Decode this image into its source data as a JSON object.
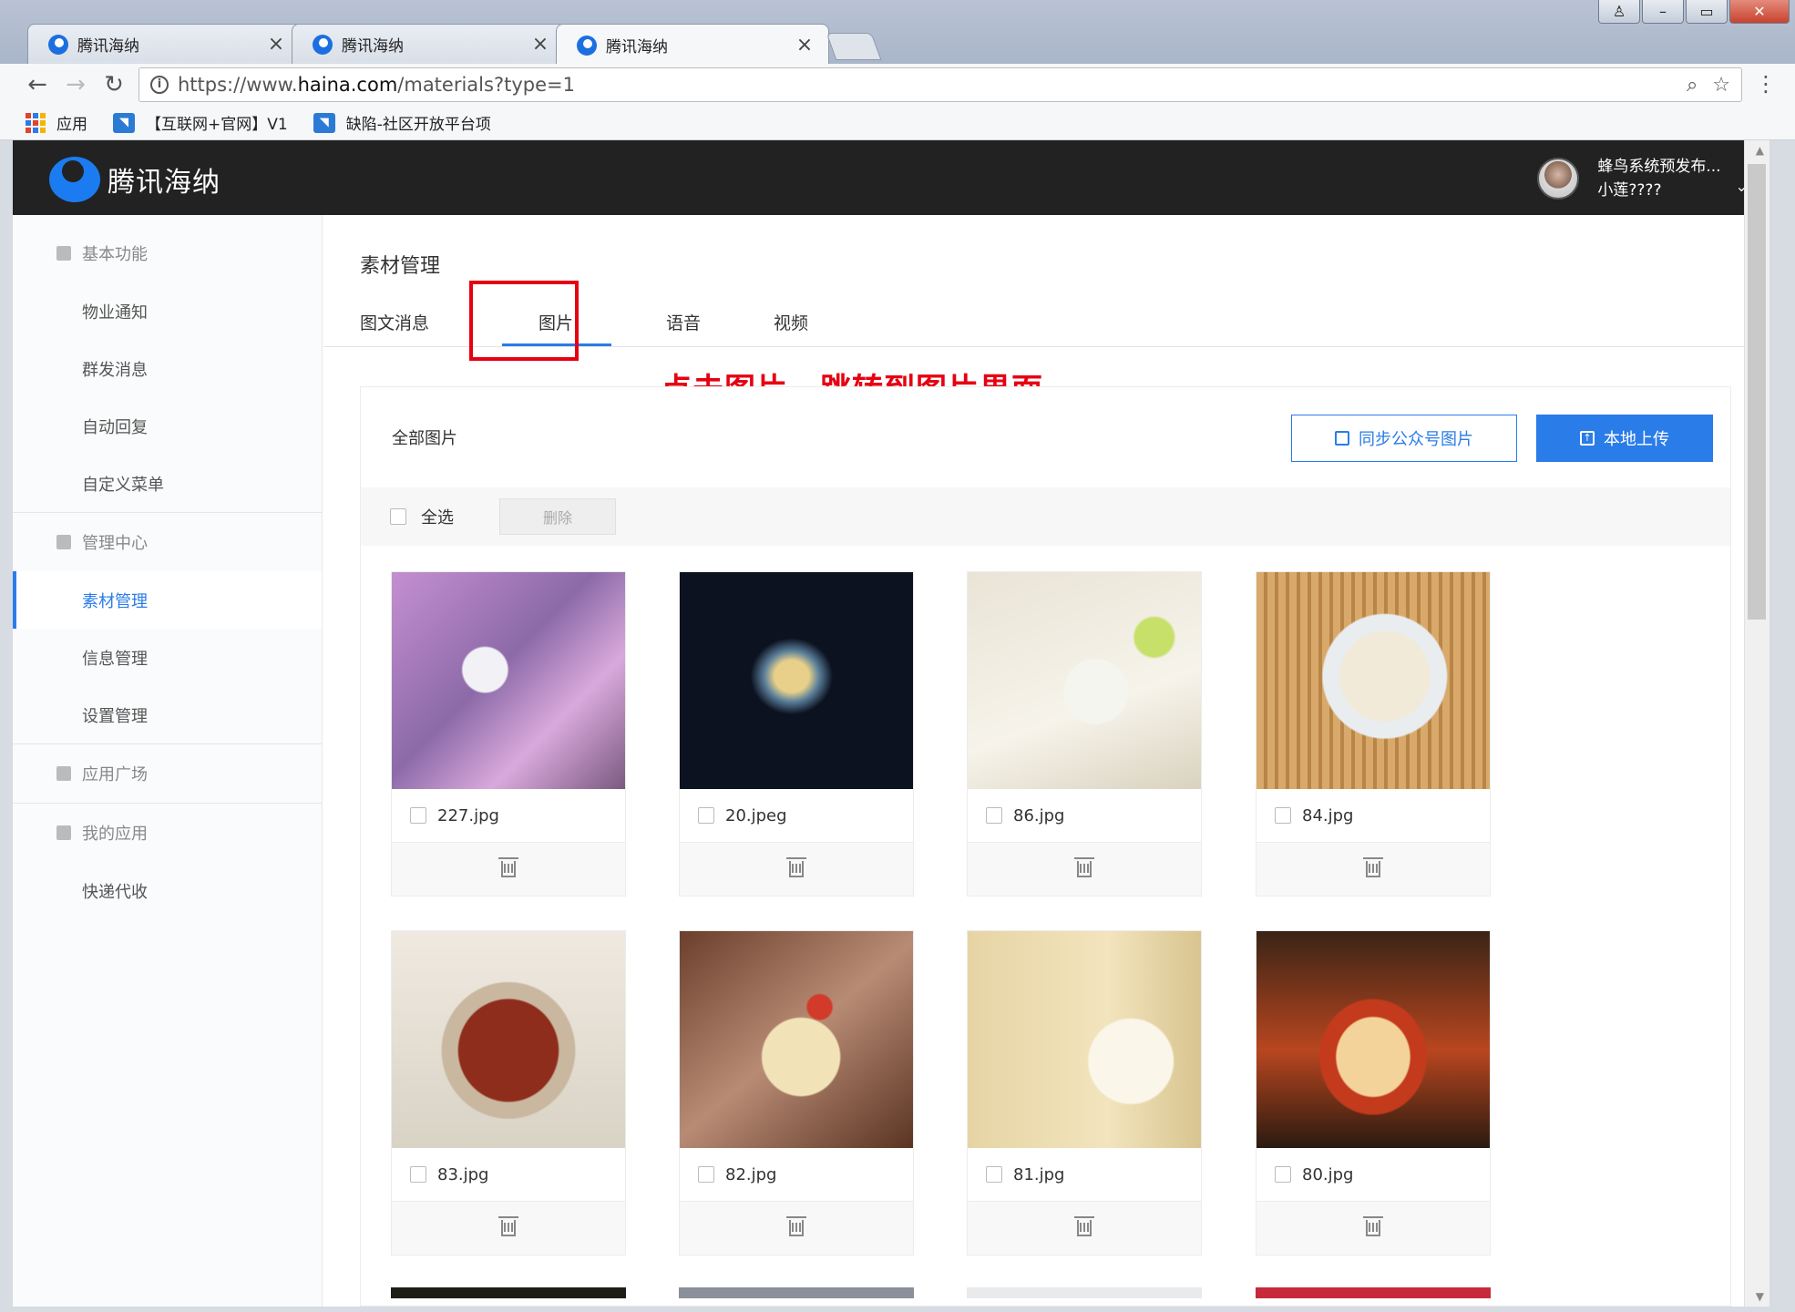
{
  "browser": {
    "tabs": [
      {
        "title": "腾讯海纳",
        "active": false
      },
      {
        "title": "腾讯海纳",
        "active": false
      },
      {
        "title": "腾讯海纳",
        "active": true
      }
    ],
    "url_prefix": "https://www.",
    "url_domain": "haina.com",
    "url_path": "/materials?type=1",
    "bookmarks": [
      {
        "label": "应用"
      },
      {
        "label": "【互联网+官网】V1"
      },
      {
        "label": "缺陷-社区开放平台项"
      }
    ]
  },
  "app": {
    "brand": "腾讯海纳",
    "user": {
      "line1": "蜂鸟系统预发布...",
      "line2": "小莲????"
    }
  },
  "sidebar": {
    "groups": [
      {
        "label": "基本功能",
        "items": [
          "物业通知",
          "群发消息",
          "自动回复",
          "自定义菜单"
        ]
      },
      {
        "label": "管理中心",
        "items": [
          "素材管理",
          "信息管理",
          "设置管理"
        ]
      },
      {
        "label": "应用广场",
        "items": []
      },
      {
        "label": "我的应用",
        "items": [
          "快递代收"
        ]
      }
    ],
    "active_item": "素材管理"
  },
  "content": {
    "page_title": "素材管理",
    "tabs": [
      "图文消息",
      "图片",
      "语音",
      "视频"
    ],
    "active_tab": "图片",
    "annotation": "点击图片，跳转到图片界面",
    "panel_title": "全部图片",
    "sync_button": "同步公众号图片",
    "upload_button": "本地上传",
    "select_all": "全选",
    "delete_button": "删除",
    "images": [
      {
        "name": "227.jpg",
        "thumb": "t1"
      },
      {
        "name": "20.jpeg",
        "thumb": "t2"
      },
      {
        "name": "86.jpg",
        "thumb": "t3"
      },
      {
        "name": "84.jpg",
        "thumb": "t4"
      },
      {
        "name": "83.jpg",
        "thumb": "t5"
      },
      {
        "name": "82.jpg",
        "thumb": "t6"
      },
      {
        "name": "81.jpg",
        "thumb": "t7"
      },
      {
        "name": "80.jpg",
        "thumb": "t8"
      }
    ]
  },
  "colors": {
    "accent": "#2a7ce8",
    "annotation_red": "#e60012",
    "header_bg": "#222222"
  }
}
